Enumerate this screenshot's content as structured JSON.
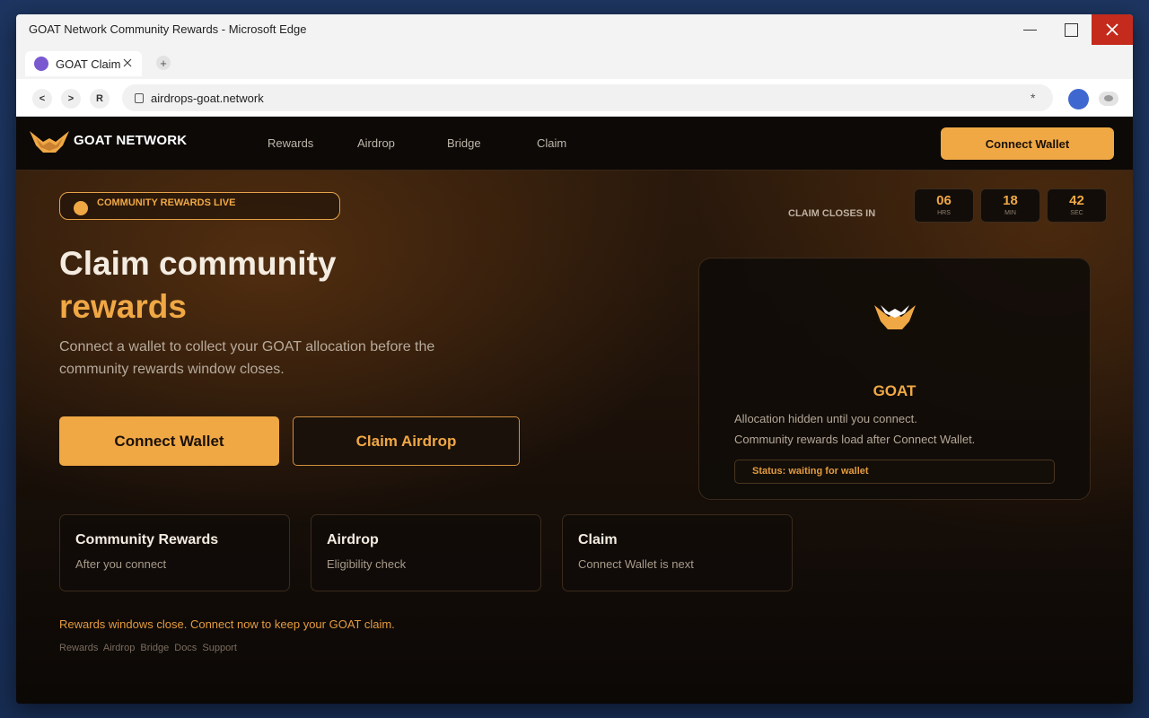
{
  "window": {
    "title": "GOAT Network Community Rewards - Microsoft Edge",
    "controls": {
      "minimize": "minimize",
      "maximize": "maximize",
      "close": "close"
    }
  },
  "browser": {
    "tab": {
      "label": "GOAT Claim",
      "favicon_color": "#7a58cf"
    },
    "nav": {
      "back": "<",
      "forward": ">",
      "reload": "R"
    },
    "address": {
      "url": "airdrops-goat.network",
      "star": "*"
    },
    "profile_color": "#3e68cf"
  },
  "site": {
    "brand": "GOAT NETWORK",
    "nav_links": [
      "Rewards",
      "Airdrop",
      "Bridge",
      "Claim"
    ],
    "nav_cta": "Connect Wallet"
  },
  "hero": {
    "badge": "COMMUNITY REWARDS LIVE",
    "title_line1": "Claim community",
    "title_line2": "rewards",
    "subtitle": "Connect a wallet to collect your GOAT allocation before the community rewards window closes.",
    "primary_button": "Connect Wallet",
    "secondary_button": "Claim Airdrop"
  },
  "countdown": {
    "label": "CLAIM CLOSES IN",
    "units": [
      {
        "value": "06",
        "unit": "HRS"
      },
      {
        "value": "18",
        "unit": "MIN"
      },
      {
        "value": "42",
        "unit": "SEC"
      }
    ]
  },
  "card": {
    "title": "GOAT",
    "line1": "Allocation hidden until you connect.",
    "line2": "Community rewards load after Connect Wallet.",
    "status": "Status: waiting for wallet"
  },
  "features": [
    {
      "title": "Community Rewards",
      "subtitle": "After you connect"
    },
    {
      "title": "Airdrop",
      "subtitle": "Eligibility check"
    },
    {
      "title": "Claim",
      "subtitle": "Connect Wallet is next"
    }
  ],
  "warning": "Rewards windows close. Connect now to keep your GOAT claim.",
  "footer_links": [
    "Rewards",
    "Airdrop",
    "Bridge",
    "Docs",
    "Support"
  ],
  "colors": {
    "accent": "#f0a845",
    "background": "#0b0907",
    "close_button": "#c42b1c"
  }
}
